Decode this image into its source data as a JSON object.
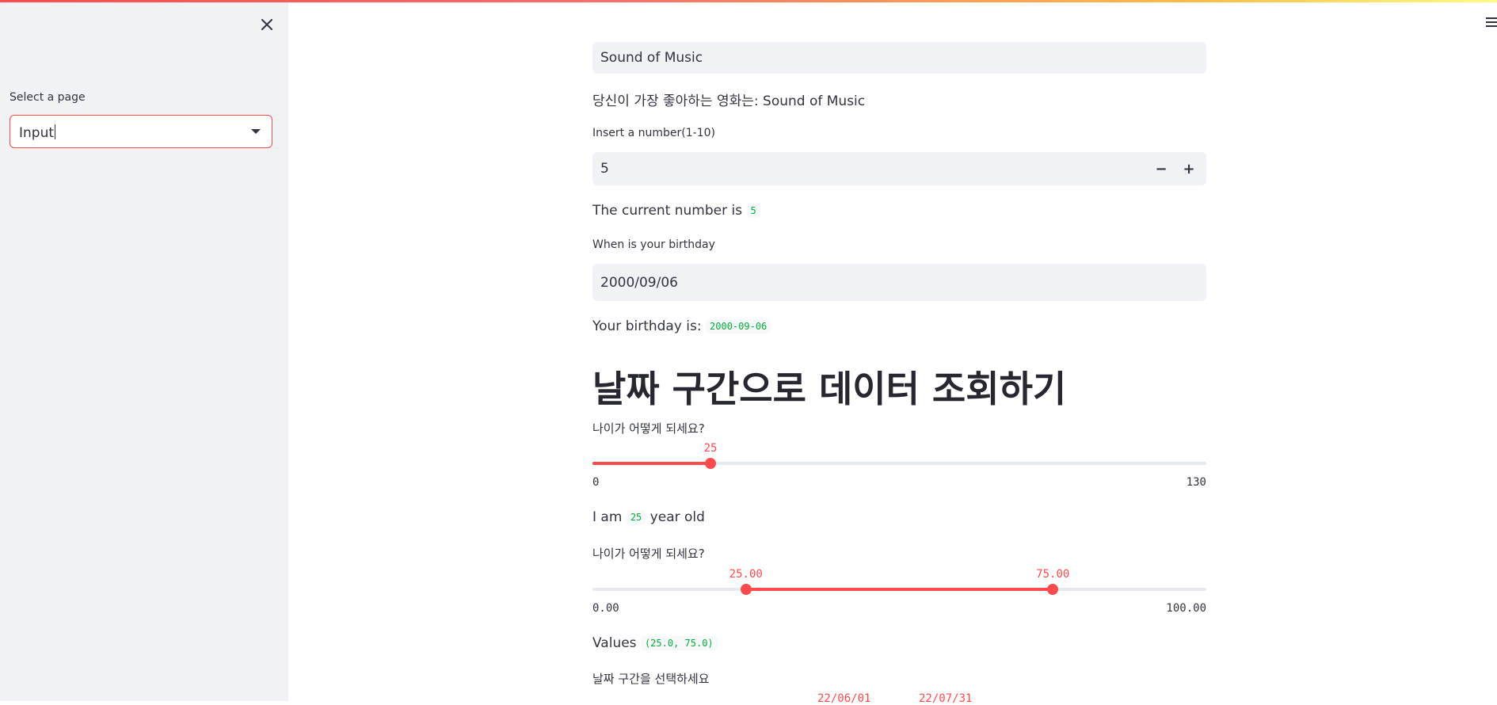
{
  "sidebar": {
    "select_label": "Select a page",
    "select_value": "Input"
  },
  "main": {
    "movie_input_value": "Sound of Music",
    "movie_output": "당신이 가장 좋아하는 영화는: Sound of Music",
    "number_label": "Insert a number(1-10)",
    "number_value": "5",
    "minus_label": "−",
    "plus_label": "+",
    "number_output_prefix": "The current number is",
    "number_output_value": "5",
    "birthday_label": "When is your birthday",
    "birthday_value": "2000/09/06",
    "birthday_output_prefix": "Your birthday is:",
    "birthday_output_value": "2000-09-06",
    "heading": "날짜 구간으로 데이터 조회하기",
    "age_slider": {
      "label": "나이가 어떻게 되세요?",
      "min": 0,
      "max": 130,
      "value": 25,
      "value_label": "25",
      "min_label": "0",
      "max_label": "130"
    },
    "age_output_prefix": "I am",
    "age_output_value": "25",
    "age_output_suffix": "year old",
    "range_slider": {
      "label": "나이가 어떻게 되세요?",
      "min": 0,
      "max": 100,
      "low": 25,
      "high": 75,
      "low_label": "25.00",
      "high_label": "75.00",
      "min_label": "0.00",
      "max_label": "100.00"
    },
    "range_output_prefix": "Values",
    "range_output_value": "(25.0, 75.0)",
    "date_range_label": "날짜 구간을 선택하세요",
    "date_range_low_label": "22/06/01",
    "date_range_high_label": "22/07/31"
  },
  "colors": {
    "accent": "#ff4b4b",
    "code_text": "#09ab3b",
    "sidebar_bg": "#f0f2f6",
    "input_bg": "#f0f2f6",
    "text": "#31333f"
  }
}
